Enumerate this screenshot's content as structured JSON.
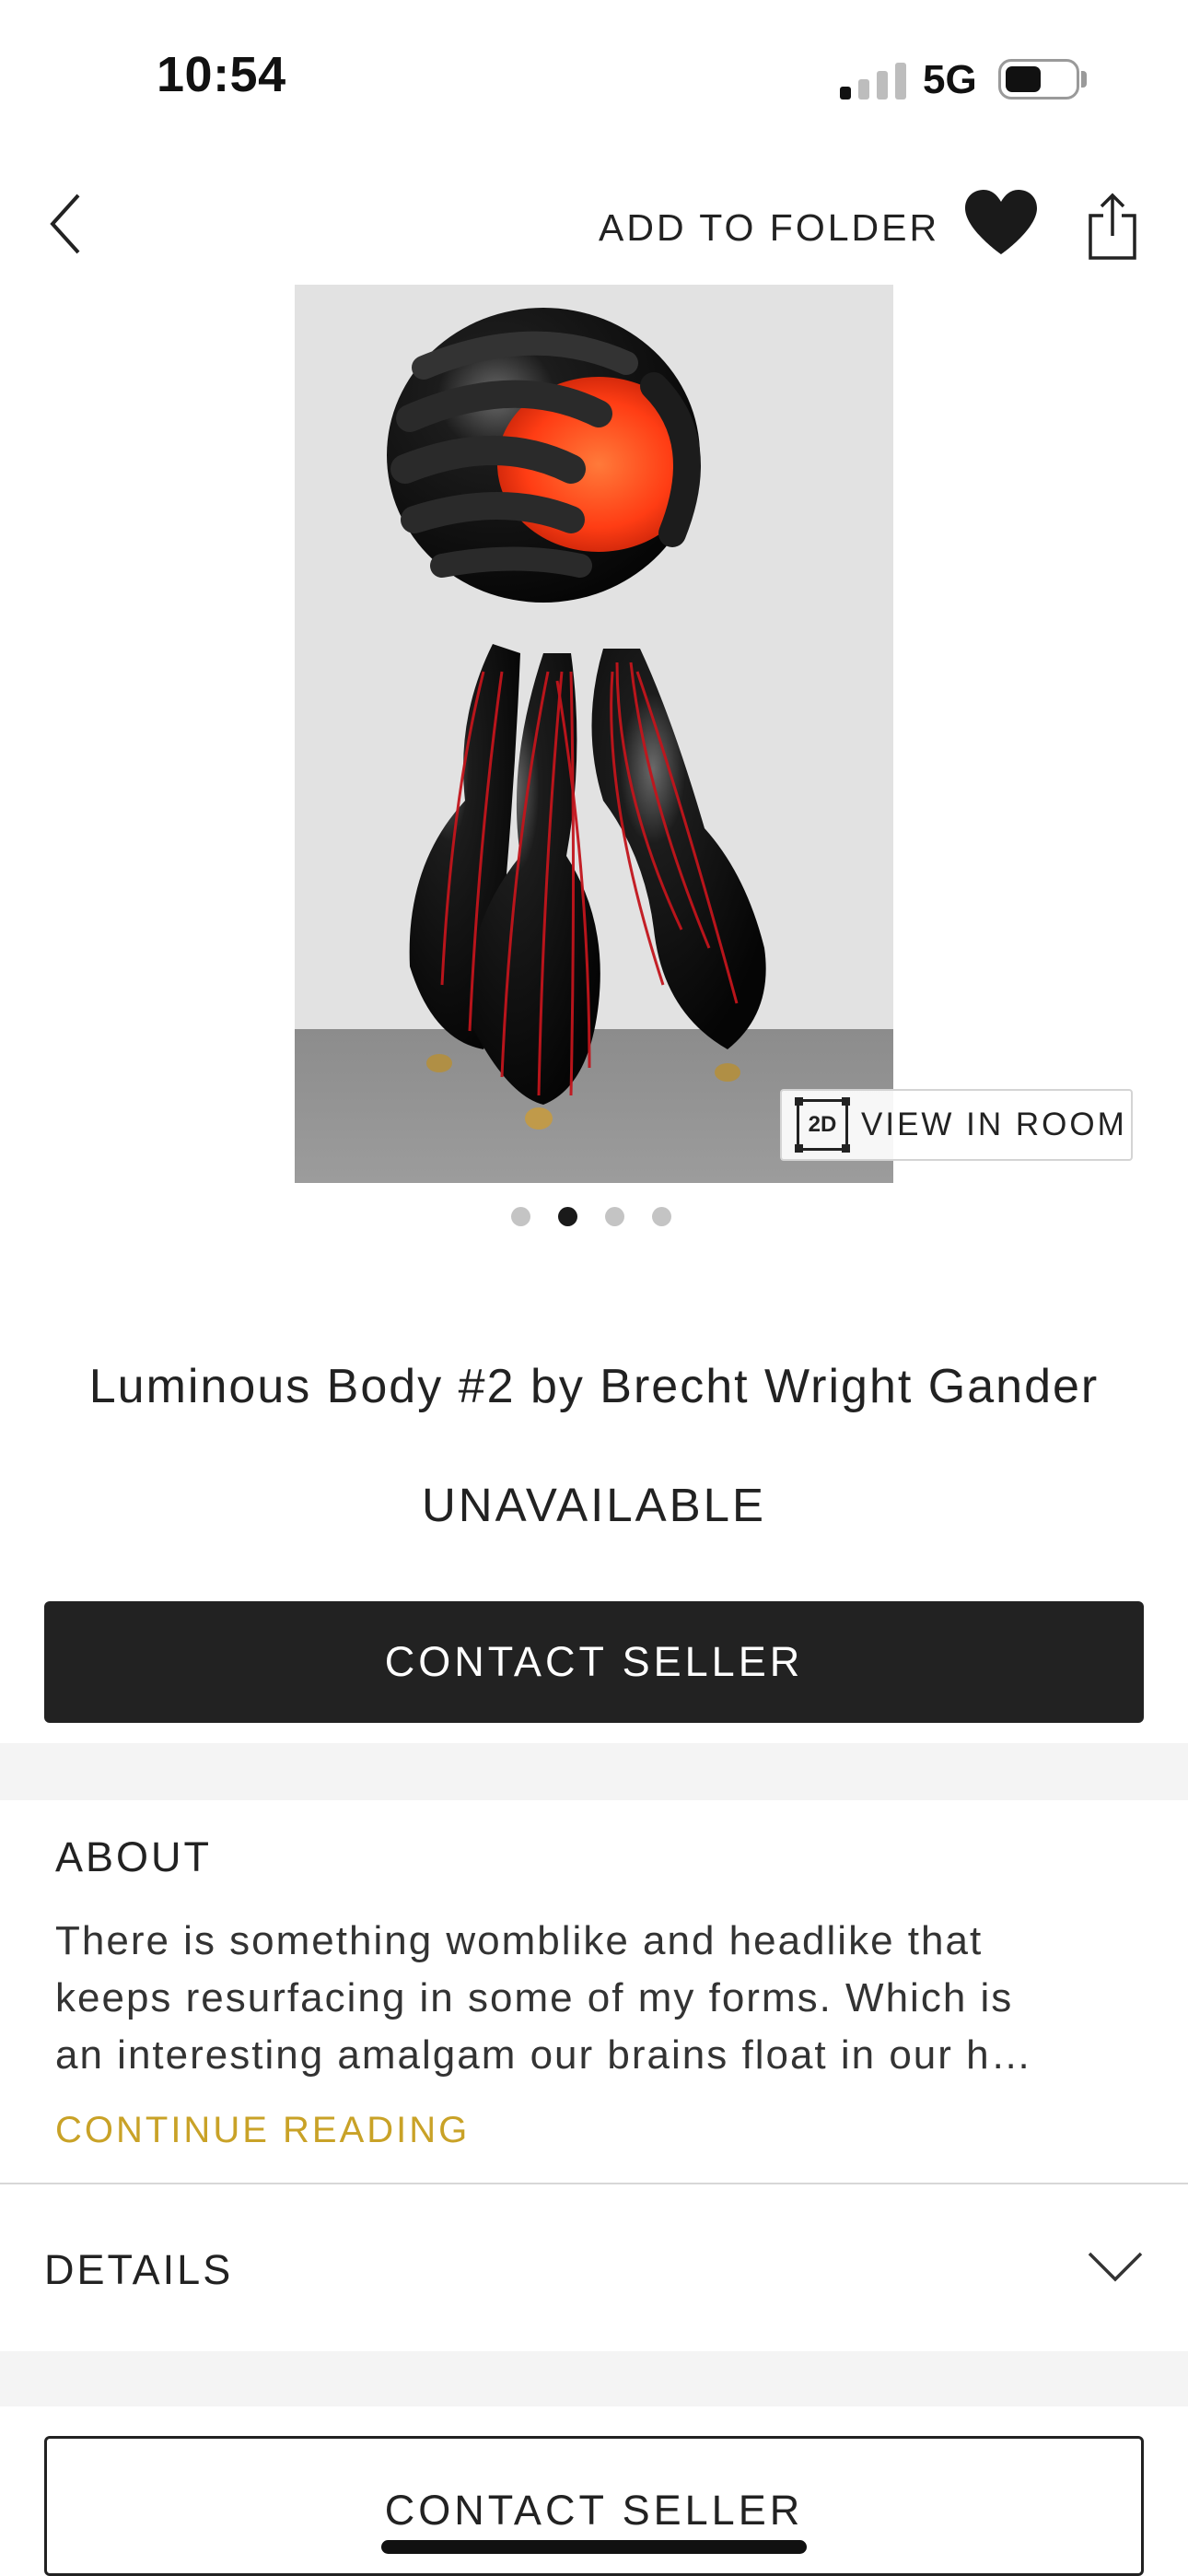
{
  "status_bar": {
    "time": "10:54",
    "network": "5G"
  },
  "nav": {
    "back_icon": "chevron-left-icon",
    "add_to_folder": "ADD TO FOLDER",
    "favorite_icon": "heart-icon",
    "share_icon": "share-icon"
  },
  "gallery": {
    "view_in_room_badge": "2D",
    "view_in_room": "VIEW IN ROOM",
    "slide_count": 4,
    "active_slide": 2
  },
  "artwork": {
    "title": "Luminous Body #2 by Brecht Wright Gander",
    "availability": "UNAVAILABLE"
  },
  "actions": {
    "contact_seller": "CONTACT SELLER",
    "contact_seller_footer": "CONTACT SELLER"
  },
  "about": {
    "heading": "ABOUT",
    "lines": [
      "There is something womblike and headlike that",
      "keeps resurfacing in some of my forms. Which is",
      "an interesting amalgam our brains float in our h…"
    ],
    "continue_reading": "CONTINUE READING"
  },
  "details": {
    "heading": "DETAILS",
    "toggle_icon": "chevron-down-icon"
  },
  "colors": {
    "primary_button": "#222222",
    "accent_link": "#c9a227",
    "band": "#f4f4f4"
  }
}
